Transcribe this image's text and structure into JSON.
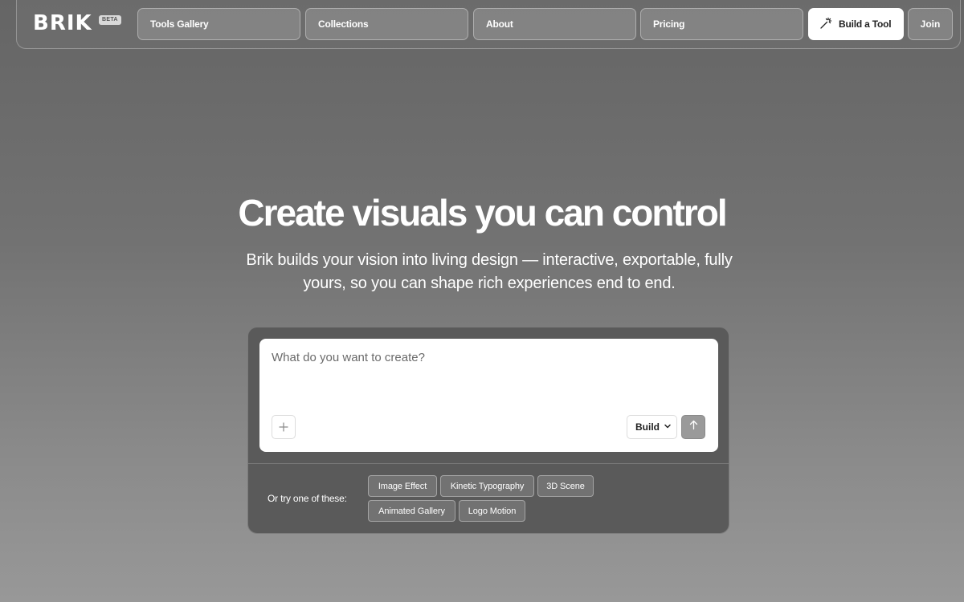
{
  "nav": {
    "logo": "BRIK",
    "badge": "BETA",
    "links": [
      {
        "label": "Tools Gallery"
      },
      {
        "label": "Collections"
      },
      {
        "label": "About"
      },
      {
        "label": "Pricing"
      }
    ],
    "cta_label": "Build a Tool",
    "cta_icon": "magic-wand-icon",
    "join_label": "Join"
  },
  "hero": {
    "title": "Create visuals you can control",
    "subtitle": "Brik builds your vision into living design — interactive, exportable, fully yours, so you can shape rich experiences end to end."
  },
  "prompt": {
    "placeholder": "What do you want to create?",
    "value": "",
    "mode_label": "Build",
    "add_icon": "plus-icon",
    "send_icon": "arrow-up-icon"
  },
  "suggestions": {
    "label": "Or try one of these:",
    "chips": [
      {
        "label": "Image Effect"
      },
      {
        "label": "Kinetic Typography"
      },
      {
        "label": "3D Scene"
      },
      {
        "label": "Animated Gallery"
      },
      {
        "label": "Logo Motion"
      }
    ]
  },
  "colors": {
    "background_top": "#656565",
    "background_bottom": "#989898",
    "card": "#5a5a5a",
    "send_button": "#9a9a9a"
  }
}
